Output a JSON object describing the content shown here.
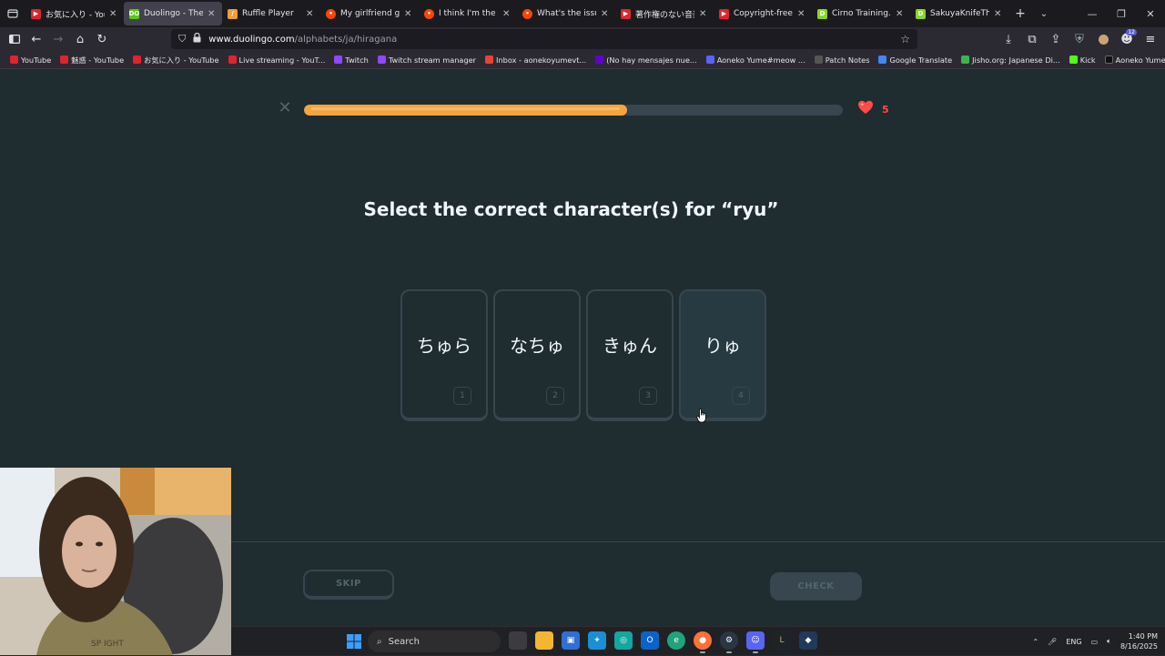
{
  "browser": {
    "tabs": [
      {
        "title": "お気に入り - YouTu",
        "favicon_color": "#e0242c",
        "active": false
      },
      {
        "title": "Duolingo - The wor",
        "favicon_color": "#58cc02",
        "active": true
      },
      {
        "title": "Ruffle Player",
        "favicon_color": "#f19e38",
        "active": false
      },
      {
        "title": "My girlfriend ghost",
        "favicon_color": "#ff4500",
        "active": false
      },
      {
        "title": "I think I'm the last p",
        "favicon_color": "#ff4500",
        "active": false
      },
      {
        "title": "What's the issue wi",
        "favicon_color": "#ff4500",
        "active": false
      },
      {
        "title": "著作権のない音楽 ·",
        "favicon_color": "#e0242c",
        "active": false
      },
      {
        "title": "Copyright-free",
        "favicon_color": "#e0242c",
        "active": false
      },
      {
        "title": "Cirno Training.swf (i",
        "favicon_color": "#8ad42c",
        "active": false
      },
      {
        "title": "SakuyaKnifeThrowe",
        "favicon_color": "#8ad42c",
        "active": false
      }
    ],
    "url": {
      "host": "www.duolingo.com",
      "path": "/alphabets/ja/hiragana"
    },
    "bookmarks": [
      {
        "label": "YouTube",
        "color": "#e0242c"
      },
      {
        "label": "魅惑 - YouTube",
        "color": "#e0242c"
      },
      {
        "label": "お気に入り - YouTube",
        "color": "#e0242c"
      },
      {
        "label": "Live streaming - YouT...",
        "color": "#e0242c"
      },
      {
        "label": "Twitch",
        "color": "#9146ff"
      },
      {
        "label": "Twitch stream manager",
        "color": "#9146ff"
      },
      {
        "label": "Inbox - aonekoyumevt...",
        "color": "#ea4335"
      },
      {
        "label": "(No hay mensajes nue...",
        "color": "#6001d2"
      },
      {
        "label": "Aoneko Yume#meow ...",
        "color": "#5865f2"
      },
      {
        "label": "Patch Notes",
        "color": "#444"
      },
      {
        "label": "Google Translate",
        "color": "#4285f4"
      },
      {
        "label": "Jisho.org: Japanese Di...",
        "color": "#3ab54a"
      },
      {
        "label": "Kick",
        "color": "#53fc18"
      },
      {
        "label": "Aoneko Yume (@aone...",
        "color": "#111"
      }
    ]
  },
  "lesson": {
    "progress_fraction": 0.6,
    "hearts": "5",
    "prompt": "Select the correct character(s) for “ryu”",
    "choices": [
      {
        "kana": "ちゅら",
        "key": "1"
      },
      {
        "kana": "なちゅ",
        "key": "2"
      },
      {
        "kana": "きゅん",
        "key": "3"
      },
      {
        "kana": "りゅ",
        "key": "4"
      }
    ],
    "skip_label": "SKIP",
    "check_label": "CHECK"
  },
  "taskbar": {
    "search_label": "Search",
    "language": "ENG",
    "time": "1:40 PM",
    "date": "8/16/2025"
  },
  "colors": {
    "page_bg": "#1f2c30",
    "progress": "#f5a53d",
    "heart": "#ff4b4b",
    "border": "#37464f"
  }
}
